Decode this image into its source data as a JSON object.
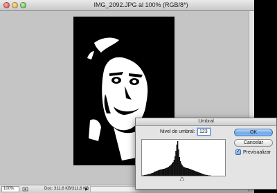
{
  "window": {
    "title": "IMG_2092.JPG al 100% (RGB/8*)"
  },
  "status_bar": {
    "zoom": "100%",
    "doc_info": "Doc: 311,6 KB/311,6 KB",
    "arrow": "▶"
  },
  "dialog": {
    "title": "Umbral",
    "threshold_label": "Nivel de umbral:",
    "threshold_value": "123",
    "ok_label": "OK",
    "cancel_label": "Cancelar",
    "preview_label": "Previsualizar",
    "preview_checked": true
  },
  "histogram": {
    "values": [
      1,
      1,
      2,
      2,
      3,
      3,
      4,
      5,
      5,
      6,
      7,
      8,
      9,
      11,
      12,
      13,
      14,
      15,
      16,
      17,
      18,
      18,
      19,
      20,
      20,
      21,
      22,
      23,
      24,
      26,
      28,
      30,
      33,
      36,
      40,
      46,
      56,
      72,
      90,
      100,
      76,
      54,
      42,
      35,
      30,
      27,
      25,
      24,
      23,
      22,
      22,
      21,
      20,
      19,
      18,
      17,
      16,
      15,
      14,
      13,
      12,
      11,
      10,
      9,
      8,
      7,
      6,
      5,
      4,
      3,
      3,
      2,
      2,
      1,
      1,
      1,
      0,
      0,
      0,
      0,
      0,
      0,
      0,
      0,
      0,
      0,
      0,
      0,
      0,
      0,
      0,
      0
    ],
    "threshold": 123
  },
  "colors": {
    "photo_background": "#000000",
    "accent": "#5d8ad0"
  },
  "icons": {
    "close": "close-icon",
    "minimize": "minimize-icon",
    "zoom": "zoom-icon",
    "checkbox": "checkmark-icon",
    "status": "status-icon"
  }
}
